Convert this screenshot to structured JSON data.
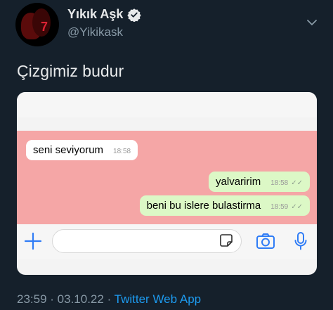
{
  "author": {
    "display_name": "Yıkık Aşk",
    "handle": "@Yikikask"
  },
  "tweet": {
    "text": "Çizgimiz budur"
  },
  "screenshot": {
    "messages": [
      {
        "direction": "incoming",
        "text": "seni seviyorum",
        "time": "18:58"
      },
      {
        "direction": "outgoing",
        "text": "yalvaririm",
        "time": "18:58"
      },
      {
        "direction": "outgoing",
        "text": "beni bu islere bulastirma",
        "time": "18:59"
      }
    ],
    "input_placeholder": ""
  },
  "meta": {
    "time": "23:59",
    "separator1": " · ",
    "date": "03.10.22",
    "separator2": " · ",
    "source": "Twitter Web App"
  },
  "colors": {
    "background": "#15202b",
    "chat_background": "#f5a6a6",
    "outgoing_bubble": "#dcf8c6",
    "link": "#1d9bf0",
    "verified": "#e7e9ea"
  },
  "icons": [
    "verified-badge-icon",
    "chevron-down-icon",
    "plus-icon",
    "sticker-icon",
    "camera-icon",
    "microphone-icon",
    "double-check-icon"
  ]
}
